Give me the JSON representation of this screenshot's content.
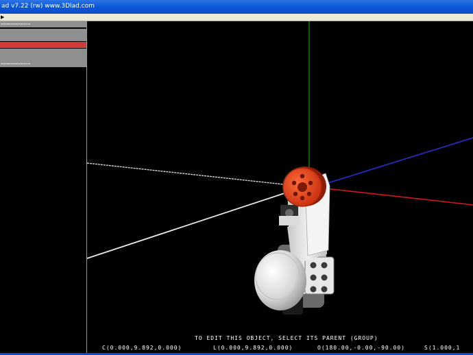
{
  "window": {
    "title": "ad v7.22 (rw)    www.3Dlad.com"
  },
  "menubar": {
    "arrow_icon": "menu-scroll-arrow-icon"
  },
  "tree": {
    "rows": [
      {
        "label": "============",
        "selected": false
      },
      {
        "label": "",
        "selected": false
      },
      {
        "label": "",
        "selected": false
      },
      {
        "label": "",
        "selected": true
      },
      {
        "label": "",
        "selected": false
      },
      {
        "label": "",
        "selected": false
      },
      {
        "label": "============",
        "selected": false
      }
    ]
  },
  "viewport": {
    "axes": {
      "x_color": "#d01818",
      "y_color": "#12b212",
      "z_color": "#2c2cd0",
      "ref_color": "#d8d8d8"
    },
    "model": {
      "hub_color": "#e03a14",
      "body_color": "#e6e6e6"
    }
  },
  "status": {
    "message": "TO EDIT THIS OBJECT, SELECT ITS PARENT (GROUP)",
    "c": "C(0.000,9.892,0.000)",
    "l": "L(0.000,9.892,0.000)",
    "o": "O(180.00,-0.00,-90.00)",
    "s": "S(1.000,1"
  }
}
